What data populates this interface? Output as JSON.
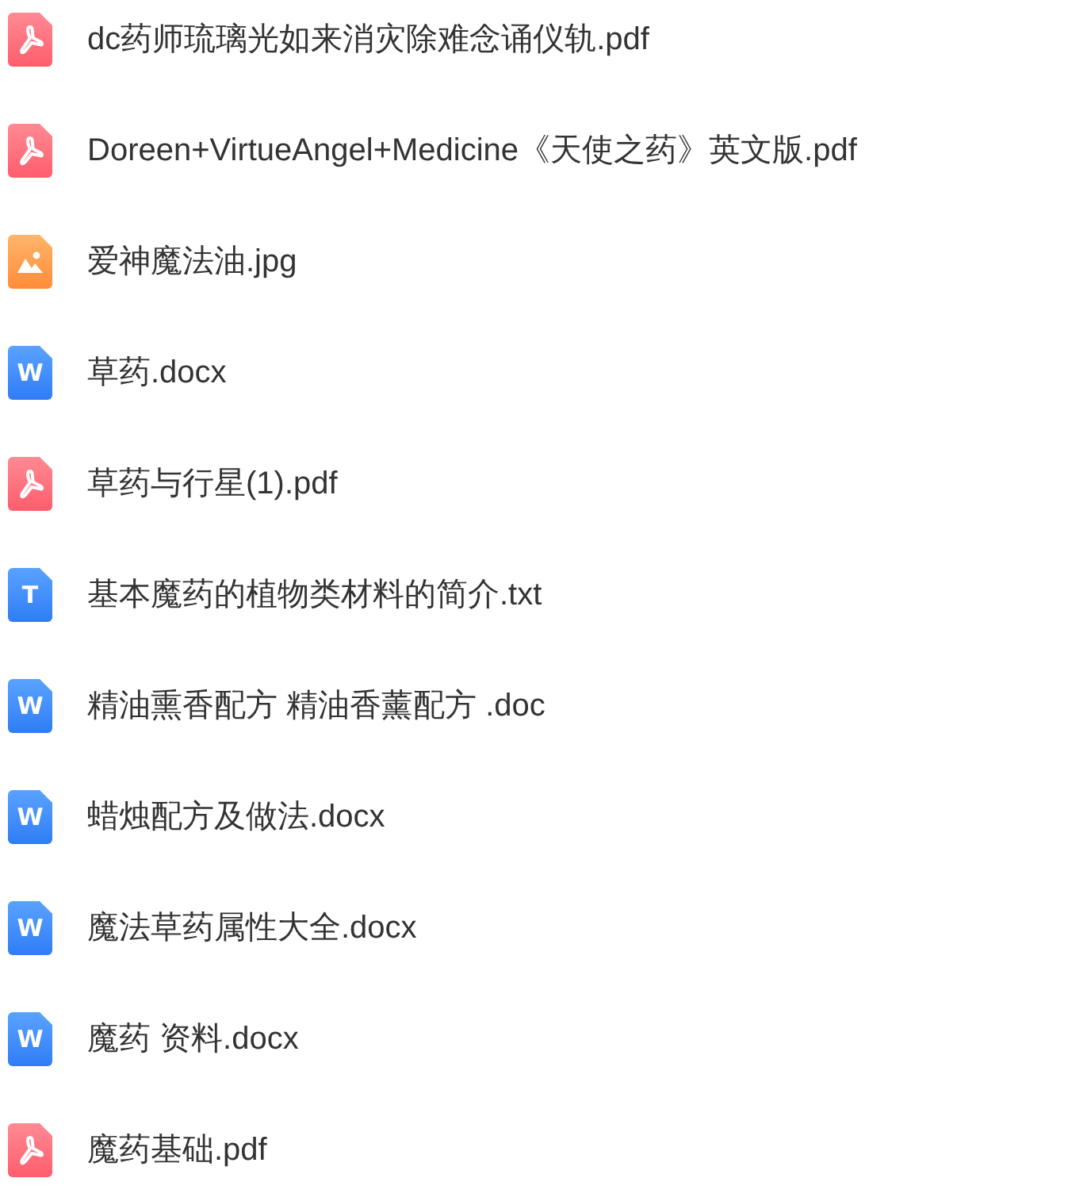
{
  "files": [
    {
      "kind": "pdf",
      "name": "dc药师琉璃光如来消灾除难念诵仪轨.pdf"
    },
    {
      "kind": "pdf",
      "name": "Doreen+VirtueAngel+Medicine《天使之药》英文版.pdf"
    },
    {
      "kind": "image",
      "name": "爱神魔法油.jpg"
    },
    {
      "kind": "letter",
      "glyph": "W",
      "name": "草药.docx"
    },
    {
      "kind": "pdf",
      "name": "草药与行星(1).pdf"
    },
    {
      "kind": "letter",
      "glyph": "T",
      "name": "基本魔药的植物类材料的简介.txt"
    },
    {
      "kind": "letter",
      "glyph": "W",
      "name": "精油熏香配方 精油香薰配方 .doc"
    },
    {
      "kind": "letter",
      "glyph": "W",
      "name": "蜡烛配方及做法.docx"
    },
    {
      "kind": "letter",
      "glyph": "W",
      "name": "魔法草药属性大全.docx"
    },
    {
      "kind": "letter",
      "glyph": "W",
      "name": "魔药 资料.docx"
    },
    {
      "kind": "pdf",
      "name": "魔药基础.pdf"
    }
  ]
}
